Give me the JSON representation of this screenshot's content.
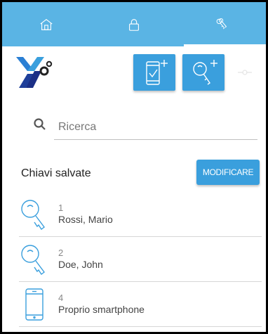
{
  "tabs": [
    {
      "name": "home",
      "icon": "home-icon",
      "active": false
    },
    {
      "name": "lock",
      "icon": "lock-icon",
      "active": false
    },
    {
      "name": "keys",
      "icon": "keys-icon",
      "active": true
    }
  ],
  "toolbar": {
    "logo": "app-logo",
    "add_phone_icon": "phone-add-icon",
    "add_key_icon": "key-add-icon"
  },
  "search": {
    "placeholder": "Ricerca",
    "value": ""
  },
  "saved_keys": {
    "title": "Chiavi salvate",
    "edit_label": "MODIFICARE",
    "items": [
      {
        "id": "1",
        "name": "Rossi, Mario",
        "icon": "key-icon"
      },
      {
        "id": "2",
        "name": "Doe, John",
        "icon": "key-icon"
      },
      {
        "id": "4",
        "name": "Proprio smartphone",
        "icon": "smartphone-icon"
      }
    ]
  },
  "colors": {
    "accent": "#3a9fdd",
    "tabbar": "#5ab4e4"
  }
}
